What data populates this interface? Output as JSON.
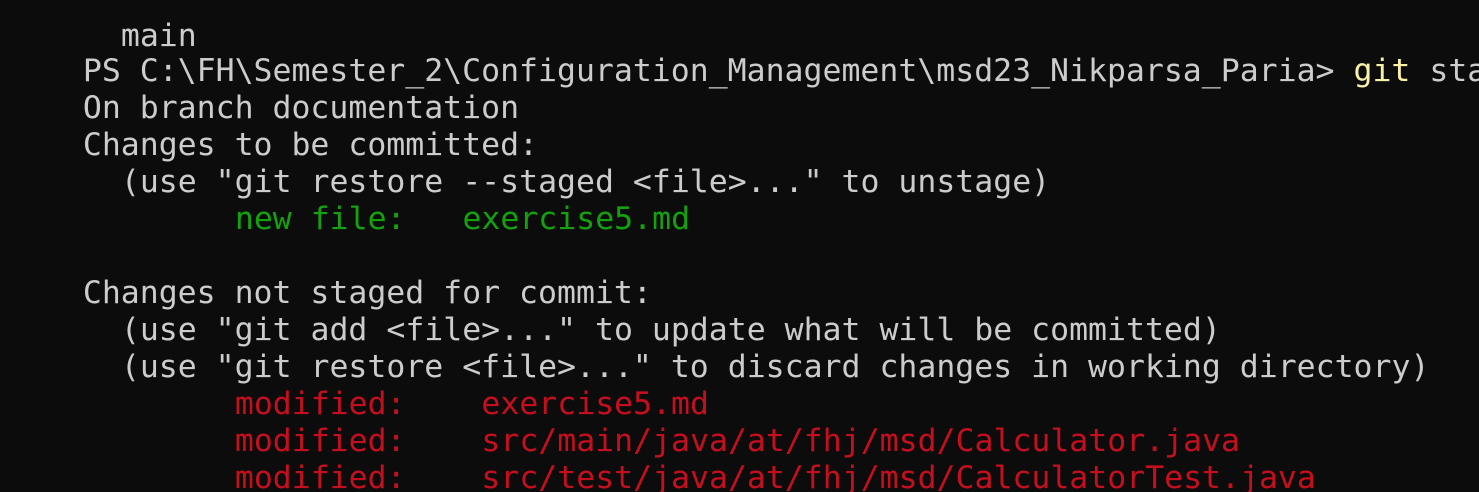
{
  "terminal": {
    "colors": {
      "background": "#0c0c0c",
      "foreground": "#cccccc",
      "command": "#f9f1a5",
      "staged": "#13a10e",
      "unstaged": "#c50f1f"
    },
    "previous_output_tail": "main",
    "prompt": "PS C:\\FH\\Semester_2\\Configuration_Management\\msd23_Nikparsa_Paria>",
    "command_name": "git",
    "command_args": "status",
    "branch_line": "On branch documentation",
    "staged_header": "Changes to be committed:",
    "staged_hint": "(use \"git restore --staged <file>...\" to unstage)",
    "staged_files": [
      {
        "status": "new file:",
        "path": "exercise5.md"
      }
    ],
    "unstaged_header": "Changes not staged for commit:",
    "unstaged_hints": [
      "(use \"git add <file>...\" to update what will be committed)",
      "(use \"git restore <file>...\" to discard changes in working directory)"
    ],
    "unstaged_files": [
      {
        "status": "modified:",
        "path": "exercise5.md"
      },
      {
        "status": "modified:",
        "path": "src/main/java/at/fhj/msd/Calculator.java"
      },
      {
        "status": "modified:",
        "path": "src/test/java/at/fhj/msd/CalculatorTest.java"
      }
    ]
  }
}
